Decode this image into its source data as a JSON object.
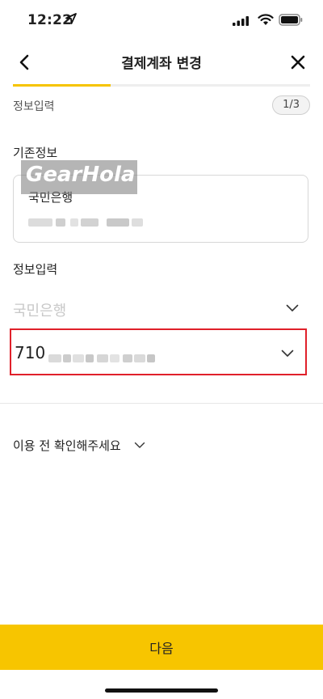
{
  "status": {
    "time": "12:22"
  },
  "nav": {
    "title": "결제계좌 변경"
  },
  "progress": {
    "value": 0.33
  },
  "step": {
    "label": "정보입력",
    "badge": "1/3"
  },
  "existing": {
    "title": "기존정보",
    "bank": "국민은행"
  },
  "watermark": {
    "text": "GearHola"
  },
  "input": {
    "title": "정보입력",
    "bank_placeholder": "국민은행",
    "account_prefix": "710"
  },
  "notice": {
    "text": "이용 전 확인해주세요"
  },
  "button": {
    "next": "다음"
  },
  "colors": {
    "accent": "#f7c500",
    "highlight_border": "#e0202a"
  }
}
